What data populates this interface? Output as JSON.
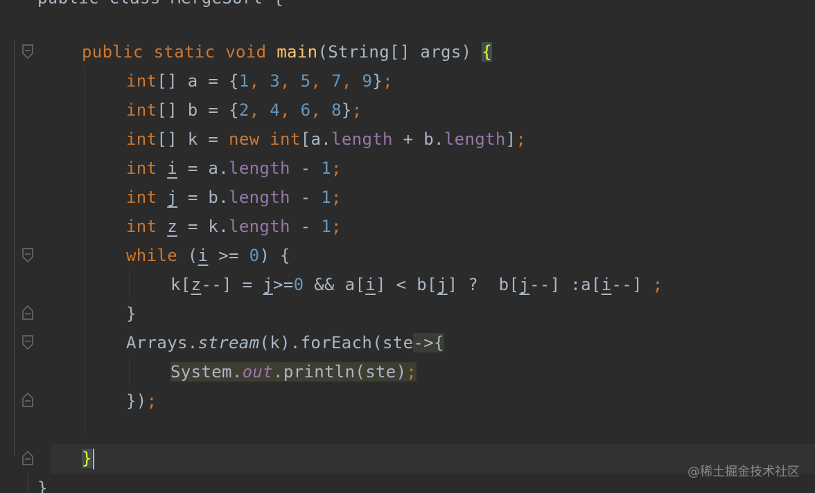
{
  "editor": {
    "language": "Java",
    "theme": "Darcula",
    "colors": {
      "background": "#2b2b2b",
      "keyword": "#cc7832",
      "method_declaration": "#ffc66d",
      "number": "#6897bb",
      "field": "#9876aa",
      "default_text": "#a9b7c6",
      "brace_match_bg": "#3b514d",
      "brace_match_fg": "#ffef28"
    },
    "lines": {
      "l1": {
        "kw1": "public",
        "kw2": "static",
        "kw3": "void",
        "fn": "main",
        "params": "(String[] args) ",
        "brace": "{"
      },
      "l2": {
        "type": "int",
        "rest": "[] a = {",
        "n1": "1",
        "c1": ", ",
        "n2": "3",
        "c2": ", ",
        "n3": "5",
        "c3": ", ",
        "n4": "7",
        "c4": ", ",
        "n5": "9",
        "close": "}",
        "semi": ";"
      },
      "l3": {
        "type": "int",
        "rest": "[] b = {",
        "n1": "2",
        "c1": ", ",
        "n2": "4",
        "c2": ", ",
        "n3": "6",
        "c3": ", ",
        "n4": "8",
        "close": "}",
        "semi": ";"
      },
      "l4": {
        "type": "int",
        "rest": "[] k = ",
        "kw_new": "new",
        "sp": " ",
        "type2": "int",
        "open": "[a.",
        "field1": "length",
        "mid": " + b.",
        "field2": "length",
        "close": "]",
        "semi": ";"
      },
      "l5": {
        "type": "int",
        "sp": " ",
        "var": "i",
        "eq": " = a.",
        "field": "length",
        "minus": " - ",
        "num": "1",
        "semi": ";"
      },
      "l6": {
        "type": "int",
        "sp": " ",
        "var": "j",
        "eq": " = b.",
        "field": "length",
        "minus": " - ",
        "num": "1",
        "semi": ";"
      },
      "l7": {
        "type": "int",
        "sp": " ",
        "var": "z",
        "eq": " = k.",
        "field": "length",
        "minus": " - ",
        "num": "1",
        "semi": ";"
      },
      "l8": {
        "kw": "while",
        "open": " (",
        "var": "i",
        "cmp": " >= ",
        "num": "0",
        "close": ") {"
      },
      "l9": {
        "t1": "k[",
        "v1": "z",
        "t2": "--] = ",
        "v2": "j",
        "t3": ">=",
        "num": "0",
        "t4": " && a[",
        "v3": "i",
        "t5": "] < b[",
        "v4": "j",
        "t6": "] ?  b[",
        "v5": "j",
        "t7": "--] :a[",
        "v6": "i",
        "t8": "--] ",
        "semi": ";"
      },
      "l10": {
        "brace": "}"
      },
      "l11": {
        "t1": "Arrays.",
        "call": "stream",
        "t2": "(k).forEach(ste",
        "arrow": "->",
        "brace": "{"
      },
      "l12": {
        "t1": "System.",
        "field": "out",
        "t2": ".println(ste)",
        "semi": ";"
      },
      "l13": {
        "t1": "})",
        "semi": ";"
      },
      "l14": {
        "brace": "}"
      }
    },
    "top_partial_text": "public class MergeSort {",
    "bottom_partial_text": "}"
  },
  "watermark": "@稀土掘金技术社区",
  "icons": {
    "fold_open": "fold-open-icon",
    "fold_close": "fold-close-icon"
  }
}
